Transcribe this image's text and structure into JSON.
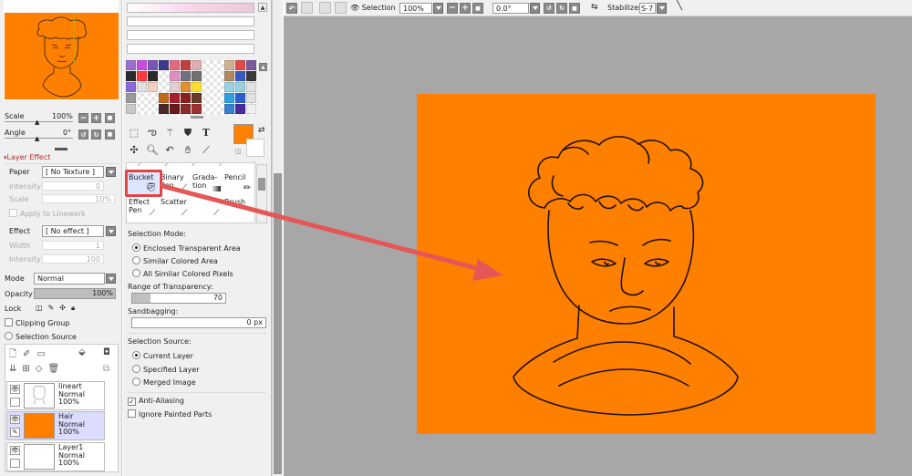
{
  "navigator": {
    "scale_label": "Scale",
    "scale_value": "100%",
    "angle_label": "Angle",
    "angle_value": "0°"
  },
  "layer_panel": {
    "section_title": "Layer Effect",
    "paper_label": "Paper",
    "paper_value": "[ No Texture ]",
    "intensity_label": "Intensity",
    "intensity_value": "0",
    "scale_label": "Scale",
    "scale_value": "10%",
    "apply_linework_label": "Apply to Linework",
    "effect_label": "Effect",
    "effect_value": "[ No effect ]",
    "width_label": "Width",
    "width_value": "1",
    "intensity2_label": "Intensity",
    "intensity2_value": "100",
    "mode_label": "Mode",
    "mode_value": "Normal",
    "opacity_label": "Opacity",
    "opacity_value": "100%",
    "lock_label": "Lock",
    "clipping_label": "Clipping Group",
    "selection_source_label": "Selection Source"
  },
  "layers": [
    {
      "name": "lineart",
      "mode": "Normal",
      "opacity": "100%"
    },
    {
      "name": "Hair",
      "mode": "Normal",
      "opacity": "100%"
    },
    {
      "name": "Layer1",
      "mode": "Normal",
      "opacity": "100%"
    }
  ],
  "tools": {
    "selected_tool": "Bucket",
    "row1": [
      "Bucket",
      "Binary Pen",
      "Grada-tion",
      "Pencil"
    ],
    "row2": [
      "Effect Pen",
      "Scatter",
      "",
      "Brush"
    ]
  },
  "bucket_options": {
    "selection_mode_label": "Selection Mode:",
    "mode_options": [
      "Enclosed Transparent Area",
      "Similar Colored Area",
      "All Similar Colored Pixels"
    ],
    "selected_mode": 0,
    "range_label": "Range of Transparency:",
    "range_value": "70",
    "range_fraction": 0.2,
    "sandbagging_label": "Sandbagging:",
    "sandbagging_value": "0 px",
    "selection_source_label": "Selection Source:",
    "source_options": [
      "Current Layer",
      "Specified Layer",
      "Merged Image"
    ],
    "selected_source": 0,
    "anti_aliasing_label": "Anti-Aliasing",
    "anti_aliasing_checked": true,
    "ignore_painted_label": "Ignore Painted Parts",
    "ignore_painted_checked": false
  },
  "toolbar": {
    "selection_label": "Selection",
    "zoom_value": "100%",
    "angle_value": "0.0°",
    "stabilizer_label": "Stabilizer",
    "stabilizer_value": "S-7"
  },
  "colors": {
    "canvas_fill": "#ff7f00",
    "current_color": "#ff7f00",
    "workspace_bg": "#a7a7a7",
    "annotation_red": "#ea5455",
    "selected_layer_bg": "#dcdcff"
  },
  "palette": [
    [
      "#9b6fd0",
      "#c94de0",
      "#7a55b8",
      "#3d3a8a",
      "#e06a80",
      "#c04040",
      "#e0b0b0",
      "#ffffff",
      "#ffffff",
      "#d0b090",
      "#e04a4a",
      "#7a5a9a"
    ],
    [
      "#2a2a2a",
      "#ff3a3a",
      "#2a2a2a",
      "#ffffff",
      "#e090c0",
      "#707080",
      "#707070",
      "#ffffff",
      "#ffffff",
      "#b08860",
      "#3a5ac0",
      "#3a3a3a"
    ],
    [
      "#8a6ad8",
      "#e0e0e0",
      "#f0d0c0",
      "#ffffff",
      "#e0d0d0",
      "#e09030",
      "#ffe030",
      "#ffffff",
      "#ffffff",
      "#9ad0e0",
      "#9ad0e0",
      "#e0e0e0"
    ],
    [
      "#9a9a9a",
      "#ffffff",
      "#ffffff",
      "#c06a20",
      "#a82030",
      "#8a2020",
      "#6a3a2a",
      "#ffffff",
      "#ffffff",
      "#30a0e0",
      "#2a60d0",
      "#e0e0e0"
    ],
    [
      "#c8c8c8",
      "#ffffff",
      "#ffffff",
      "#4a2a2a",
      "#6a1a1a",
      "#8a2a2a",
      "#a03030",
      "#ffffff",
      "#ffffff",
      "#3a80d0",
      "#4a2a9a",
      "#f0f0f0"
    ]
  ]
}
